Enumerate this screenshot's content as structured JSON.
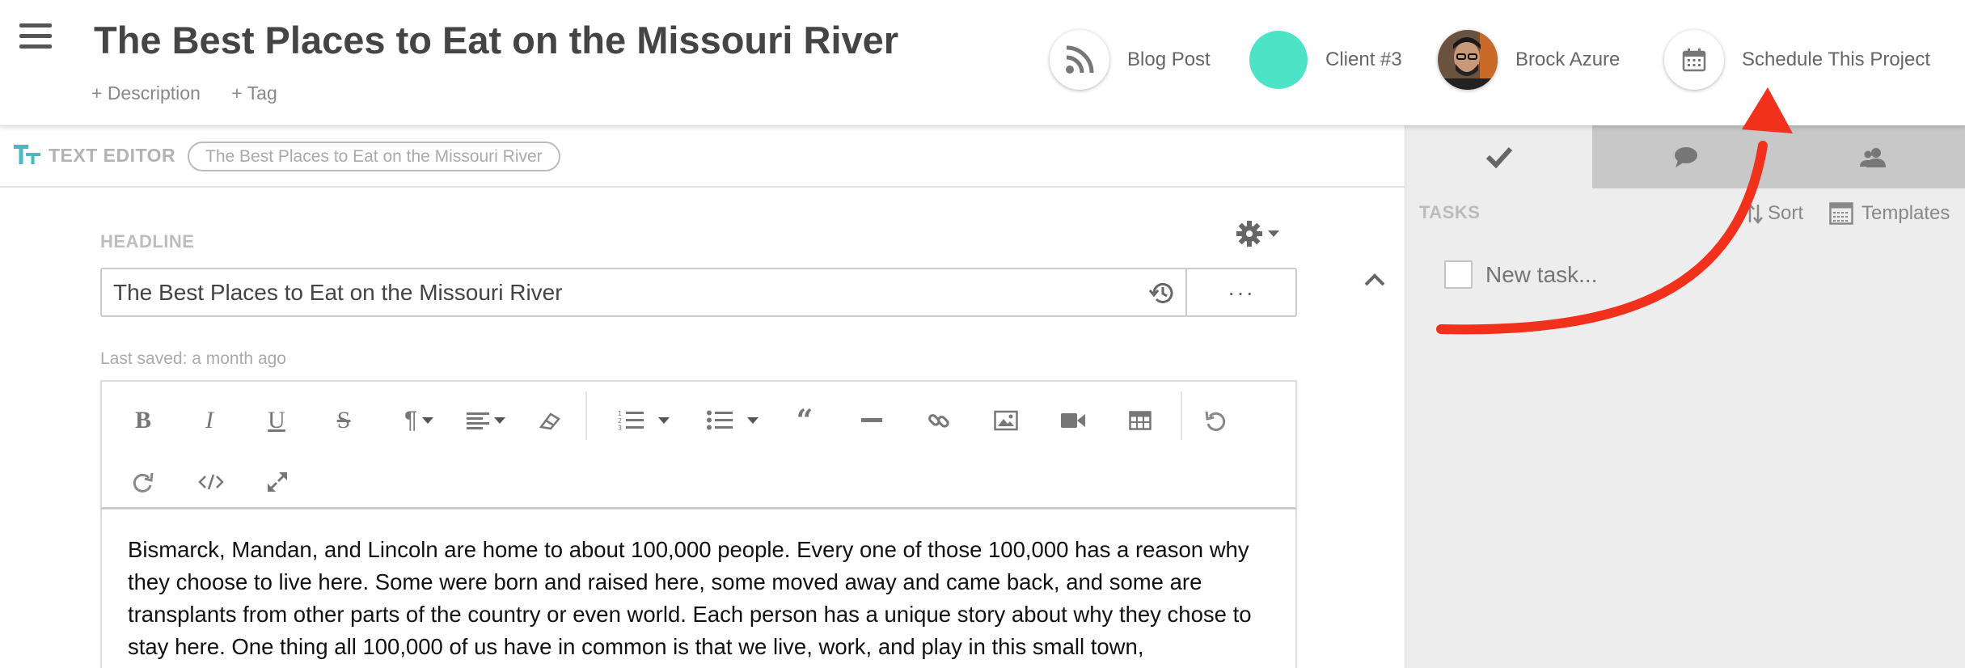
{
  "header": {
    "title": "The Best Places to Eat on the Missouri River",
    "description_link": "+ Description",
    "tag_link": "+ Tag",
    "items": [
      {
        "label": "Blog Post",
        "icon": "rss-icon"
      },
      {
        "label": "Client #3",
        "icon": "client-color-dot",
        "color": "#4de3c6"
      },
      {
        "label": "Brock Azure",
        "icon": "avatar"
      },
      {
        "label": "Schedule This Project",
        "icon": "calendar-icon"
      }
    ]
  },
  "editor": {
    "section_label": "TEXT EDITOR",
    "pill": "The Best Places to Eat on the Missouri River",
    "headline_label": "HEADLINE",
    "headline_value": "The Best Places to Eat on the Missouri River",
    "more_label": "···",
    "last_saved": "Last saved: a month ago",
    "toolbar": [
      "bold-icon",
      "italic-icon",
      "underline-icon",
      "strikethrough-icon",
      "paragraph-icon",
      "align-icon",
      "eraser-icon",
      "ordered-list-icon",
      "unordered-list-icon",
      "blockquote-icon",
      "horizontal-rule-icon",
      "link-icon",
      "image-icon",
      "video-icon",
      "table-icon",
      "undo-icon",
      "redo-icon",
      "code-view-icon",
      "fullscreen-icon"
    ],
    "body_text": "Bismarck, Mandan, and Lincoln are home to about 100,000 people. Every one of those 100,000 has a reason why they choose to live here. Some were born and raised here, some moved away and came back, and some are transplants from other parts of the country or even world. Each person has a unique story about why they chose to stay here. One thing all 100,000 of us have in common is that we live, work, and play in this small town,"
  },
  "right_panel": {
    "tabs": [
      "check-icon",
      "comment-icon",
      "people-icon"
    ],
    "tasks_label": "TASKS",
    "sort_label": "Sort",
    "templates_label": "Templates",
    "new_task_placeholder": "New task..."
  },
  "colors": {
    "accent_teal": "#4bb8c4",
    "client_color": "#4de3c6",
    "annotation_arrow": "#f2311c"
  }
}
